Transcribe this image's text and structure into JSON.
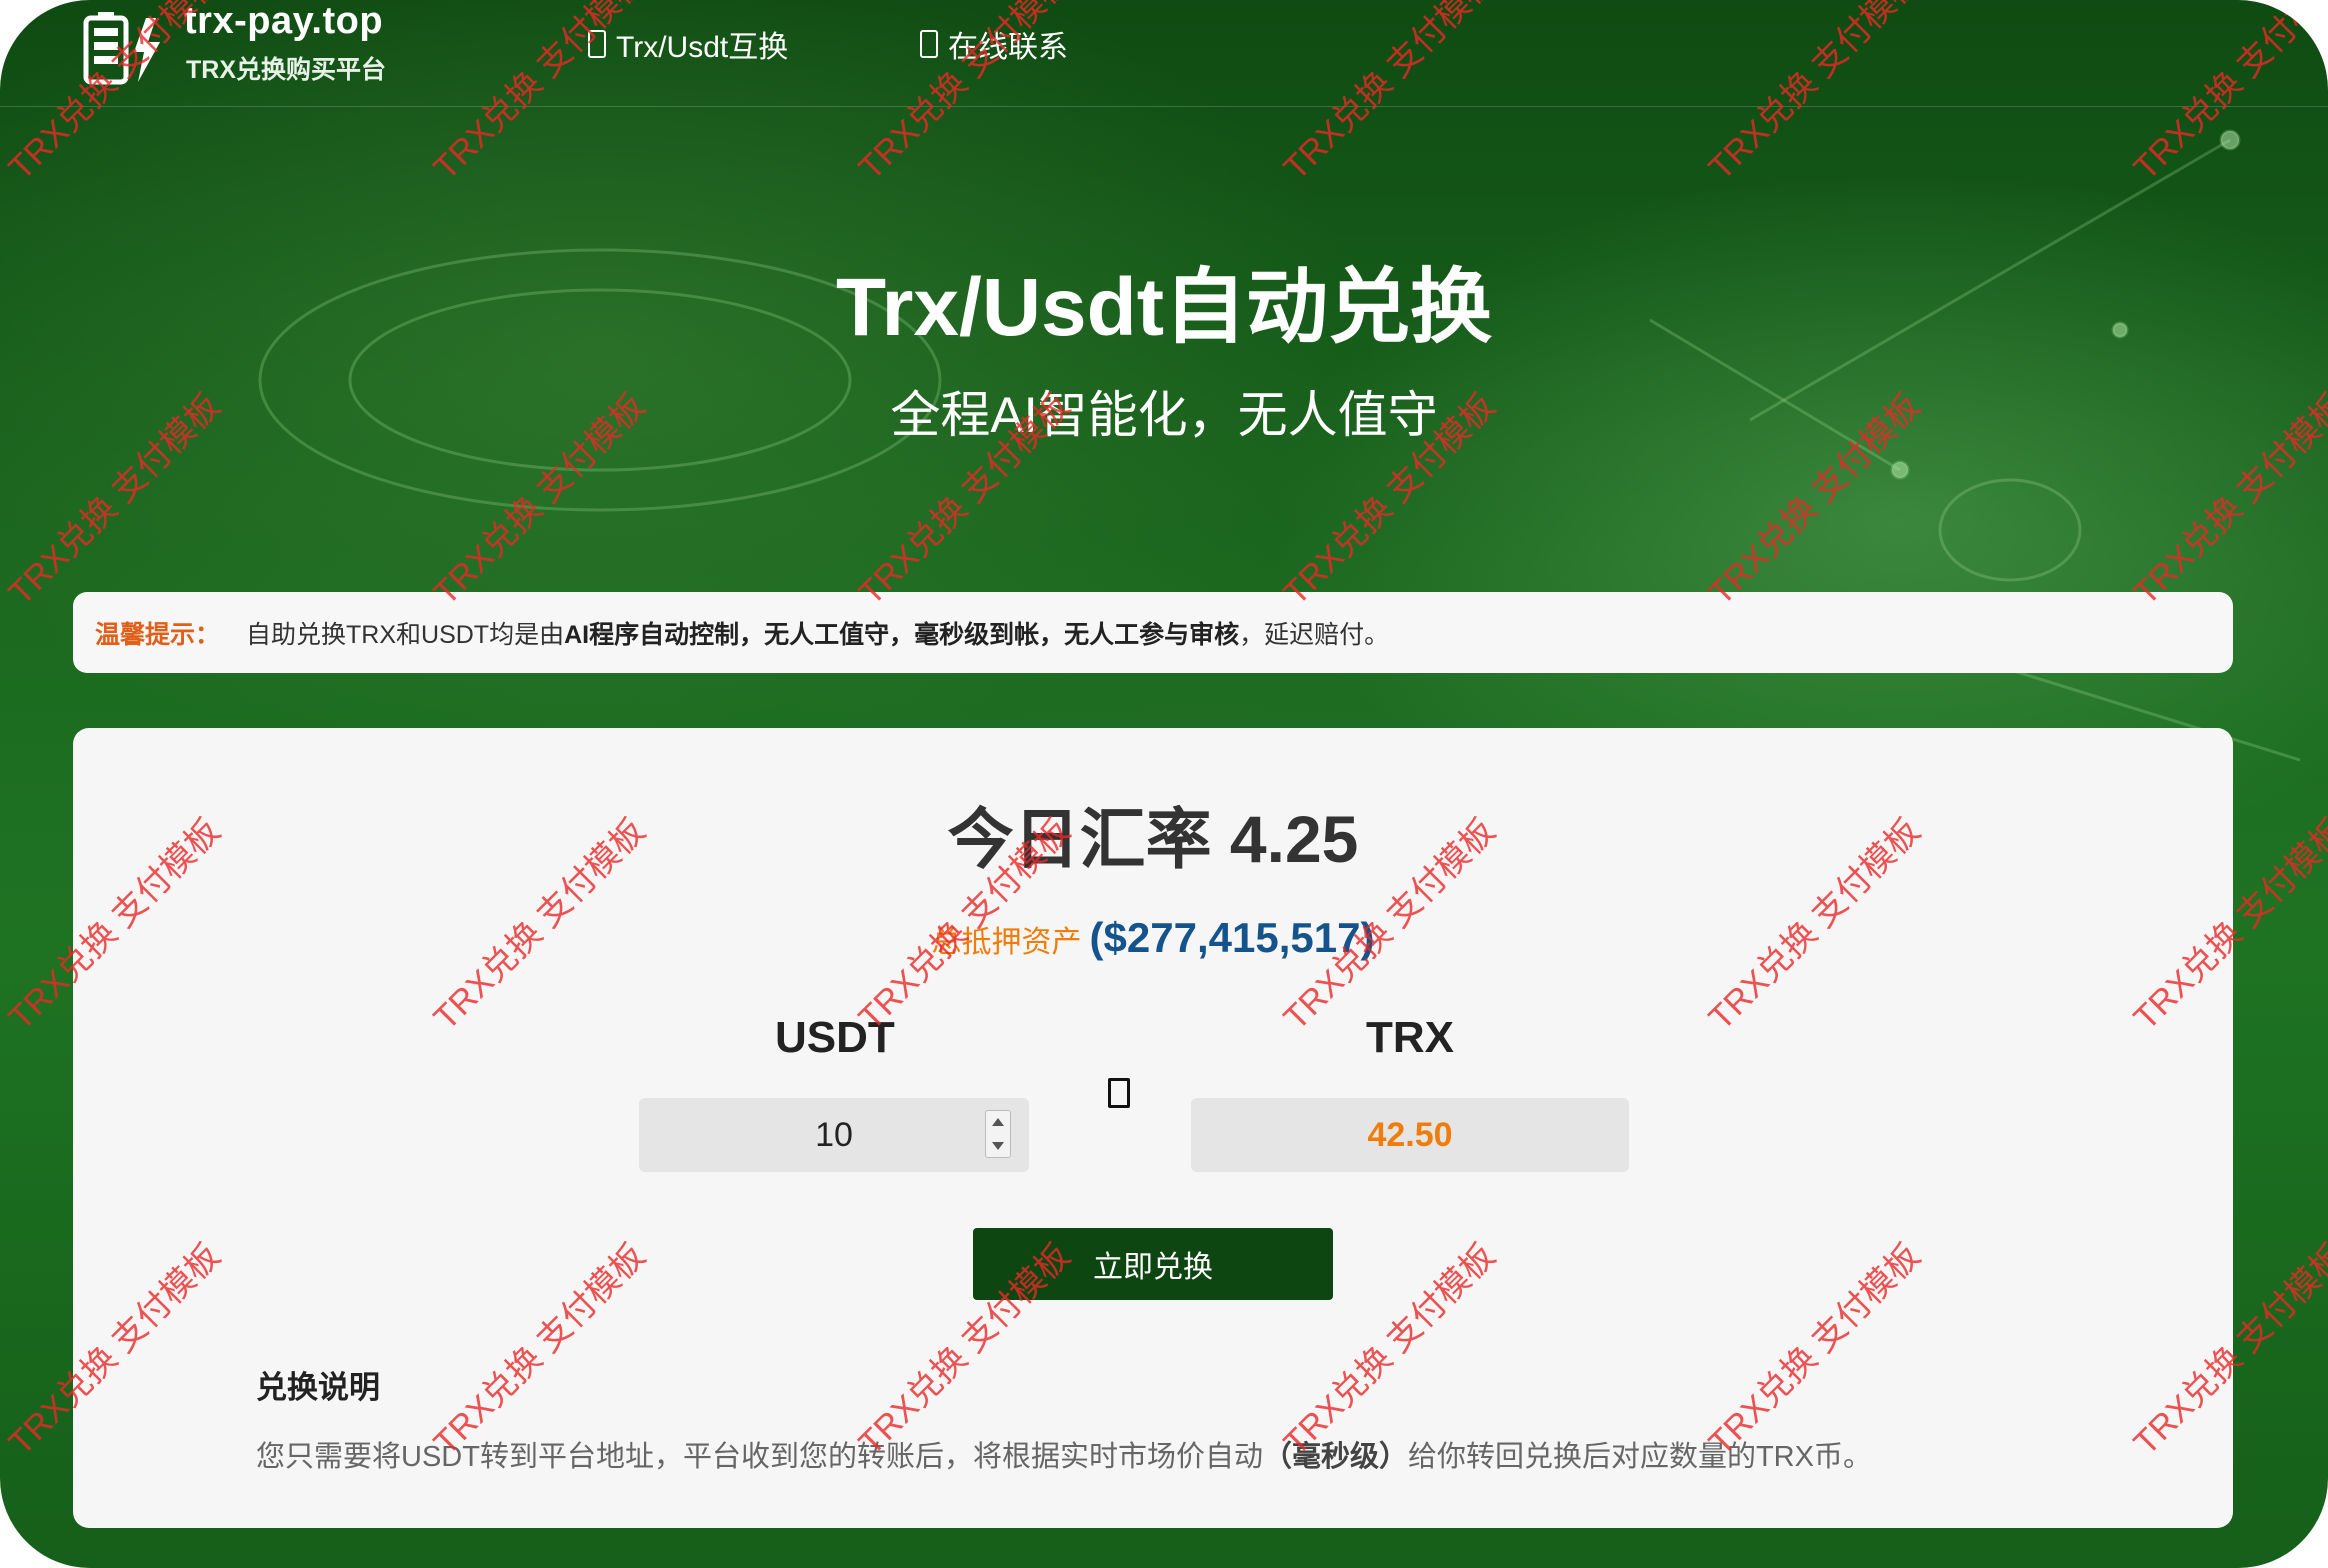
{
  "brand": {
    "name": "trx-pay.top",
    "subtitle": "TRX兑换购买平台"
  },
  "nav": [
    {
      "label": "Trx/Usdt互换",
      "icon": "exchange-icon"
    },
    {
      "label": "在线联系",
      "icon": "contact-icon"
    }
  ],
  "hero": {
    "title": "Trx/Usdt自动兑换",
    "subtitle": "全程AI智能化，无人值守"
  },
  "notice": {
    "label": "温馨提示：",
    "text_1": "自助兑换TRX和USDT均是由",
    "text_2": "AI程序自动控制，无人工值守，毫秒级到帐，无人工参与审核",
    "text_3": "，延迟赔付。"
  },
  "exchange": {
    "rate_text": "今日汇率 4.25",
    "assets_label": "总抵押资产",
    "assets_value": "($277,415,517)",
    "from_currency": "USDT",
    "to_currency": "TRX",
    "from_amount": "10",
    "to_amount": "42.50",
    "button_label": "立即兑换"
  },
  "description": {
    "title": "兑换说明",
    "text_1": "您只需要将USDT转到平台地址，平台收到您的转账后，将根据实时市场价自动",
    "text_2": "（毫秒级）",
    "text_3": "给你转回兑换后对应数量的TRX币。"
  },
  "watermark": "TRX兑换 支付模板",
  "colors": {
    "brand_green": "#0d4611",
    "accent_orange": "#f07d0a",
    "value_blue": "#14538c",
    "watermark_red": "#eb2828"
  }
}
